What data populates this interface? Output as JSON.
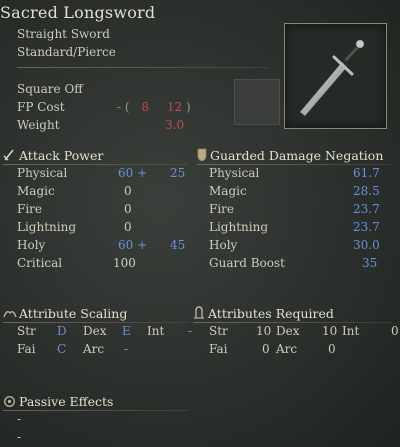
{
  "title": "Sacred Longsword",
  "weapon_class": "Straight Sword",
  "damage_type": "Standard/Pierce",
  "skill": "Square Off",
  "fp_cost": {
    "label": "FP Cost",
    "prefix": "- (",
    "value1": "8",
    "value2": "12",
    "suffix": ")"
  },
  "weight": {
    "label": "Weight",
    "value": "3.0"
  },
  "attack_power": {
    "header": "Attack Power",
    "rows": [
      {
        "label": "Physical",
        "base": "60 +",
        "bonus": "25"
      },
      {
        "label": "Magic",
        "base": "0",
        "bonus": ""
      },
      {
        "label": "Fire",
        "base": "0",
        "bonus": ""
      },
      {
        "label": "Lightning",
        "base": "0",
        "bonus": ""
      },
      {
        "label": "Holy",
        "base": "60 +",
        "bonus": "45"
      },
      {
        "label": "Critical",
        "base": "100",
        "bonus": ""
      }
    ]
  },
  "guarded_negation": {
    "header": "Guarded Damage Negation",
    "rows": [
      {
        "label": "Physical",
        "value": "61.7"
      },
      {
        "label": "Magic",
        "value": "28.5"
      },
      {
        "label": "Fire",
        "value": "23.7"
      },
      {
        "label": "Lightning",
        "value": "23.7"
      },
      {
        "label": "Holy",
        "value": "30.0"
      },
      {
        "label": "Guard Boost",
        "value": "35"
      }
    ]
  },
  "attribute_scaling": {
    "header": "Attribute Scaling",
    "str_label": "Str",
    "str_val": "D",
    "dex_label": "Dex",
    "dex_val": "E",
    "int_label": "Int",
    "int_val": "-",
    "fai_label": "Fai",
    "fai_val": "C",
    "arc_label": "Arc",
    "arc_val": "-"
  },
  "attributes_required": {
    "header": "Attributes Required",
    "str_label": "Str",
    "str_val": "10",
    "dex_label": "Dex",
    "dex_val": "10",
    "int_label": "Int",
    "int_val": "0",
    "fai_label": "Fai",
    "fai_val": "0",
    "arc_label": "Arc",
    "arc_val": "0"
  },
  "passive_effects": {
    "header": "Passive Effects",
    "line1": "-",
    "line2": "-"
  },
  "icons": [
    "sword-icon",
    "shield-icon",
    "scaling-icon",
    "requirement-icon",
    "passive-icon"
  ]
}
